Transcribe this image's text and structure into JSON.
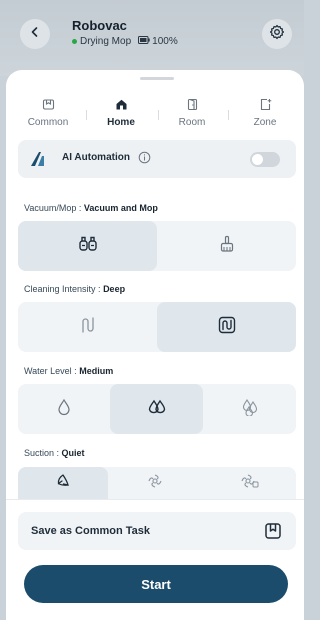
{
  "header": {
    "title": "Robovac",
    "status_text": "Drying Mop",
    "battery_text": "100%",
    "status_color": "#28a745"
  },
  "tabs": [
    {
      "label": "Common",
      "icon": "common-icon",
      "active": false
    },
    {
      "label": "Home",
      "icon": "home-icon",
      "active": true
    },
    {
      "label": "Room",
      "icon": "room-door-icon",
      "active": false
    },
    {
      "label": "Zone",
      "icon": "zone-add-icon",
      "active": false
    }
  ],
  "ai_automation": {
    "label": "AI Automation",
    "enabled": false
  },
  "vacuum_mop": {
    "label": "Vacuum/Mop :",
    "value": "Vacuum and Mop",
    "options": [
      "vacuum-and-mop-icon",
      "mop-only-icon"
    ],
    "selected_index": 0
  },
  "cleaning_intensity": {
    "label": "Cleaning Intensity :",
    "value": "Deep",
    "options": [
      "standard-path-icon",
      "deep-path-icon"
    ],
    "selected_index": 1
  },
  "water_level": {
    "label": "Water Level :",
    "value": "Medium",
    "options": [
      "water-low-icon",
      "water-medium-icon",
      "water-high-icon"
    ],
    "selected_index": 1
  },
  "suction": {
    "label": "Suction :",
    "value": "Quiet",
    "options": [
      "suction-quiet-icon",
      "suction-standard-icon",
      "suction-turbo-icon"
    ],
    "selected_index": 0
  },
  "save_task": {
    "label": "Save as Common Task"
  },
  "start_button": {
    "label": "Start",
    "color": "#1c4c6c"
  }
}
